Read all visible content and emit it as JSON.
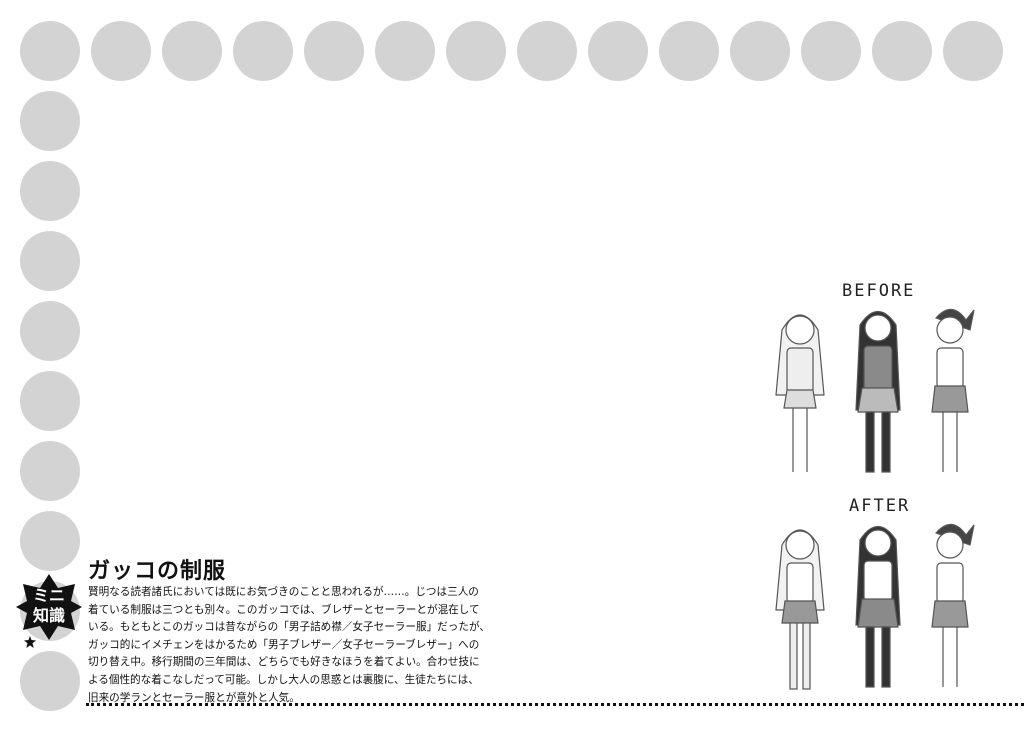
{
  "section": {
    "badge_line1": "ミニ",
    "badge_line2": "知識",
    "title": "ガッコの制服",
    "paragraph_lines": [
      "賢明なる読者諸氏においては既にお気づきのことと思われるが……。じつは三人の",
      "着ている制服は三つとも別々。このガッコでは、ブレザーとセーラーとが混在して",
      "いる。もともとこのガッコは昔ながらの「男子詰め襟／女子セーラー服」だったが、",
      "ガッコ的にイメチェンをはかるため「男子ブレザー／女子セーラーブレザー」への",
      "切り替え中。移行期間の三年間は、どちらでも好きなほうを着てよい。合わせ技に",
      "よる個性的な着こなしだって可能。しかし大人の思惑とは裏腹に、生徒たちには、",
      "旧来の学ランとセーラー服とが意外と人気。"
    ]
  },
  "illustration": {
    "before_label": "BEFORE",
    "after_label": "AFTER"
  },
  "colors": {
    "circle": "#d3d3d3",
    "ink": "#111111"
  }
}
